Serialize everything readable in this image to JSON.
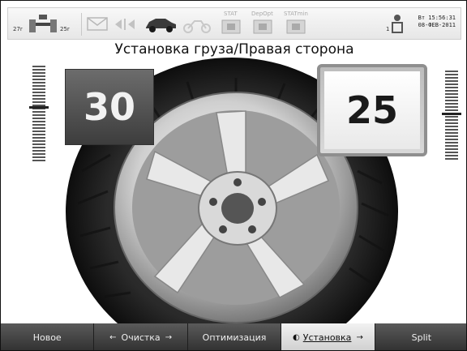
{
  "status_bar": {
    "spindle_left_temp": "27r",
    "spindle_right_temp": "25r",
    "stat_labels": [
      "STAT",
      "DepOpt",
      "STATmin"
    ],
    "user_number": "1",
    "datetime_line1": "Вт 15:56:31",
    "datetime_line2": "08-ФЕВ-2011"
  },
  "title": "Установка груза/Правая сторона",
  "left_value": "30",
  "right_value": "25",
  "bottom_menu": [
    {
      "label": "Новое",
      "active": false,
      "left_arrow": "",
      "right_arrow": ""
    },
    {
      "label": "Очистка",
      "active": false,
      "left_arrow": "←",
      "right_arrow": "→"
    },
    {
      "label": "Оптимизация",
      "active": false,
      "left_arrow": "",
      "right_arrow": ""
    },
    {
      "label": "Установка",
      "active": true,
      "left_arrow": "◐",
      "right_arrow": "→"
    },
    {
      "label": "Split",
      "active": false,
      "left_arrow": "",
      "right_arrow": ""
    }
  ],
  "colors": {
    "bar_dark": "#303030",
    "active": "#e6e6e6"
  }
}
